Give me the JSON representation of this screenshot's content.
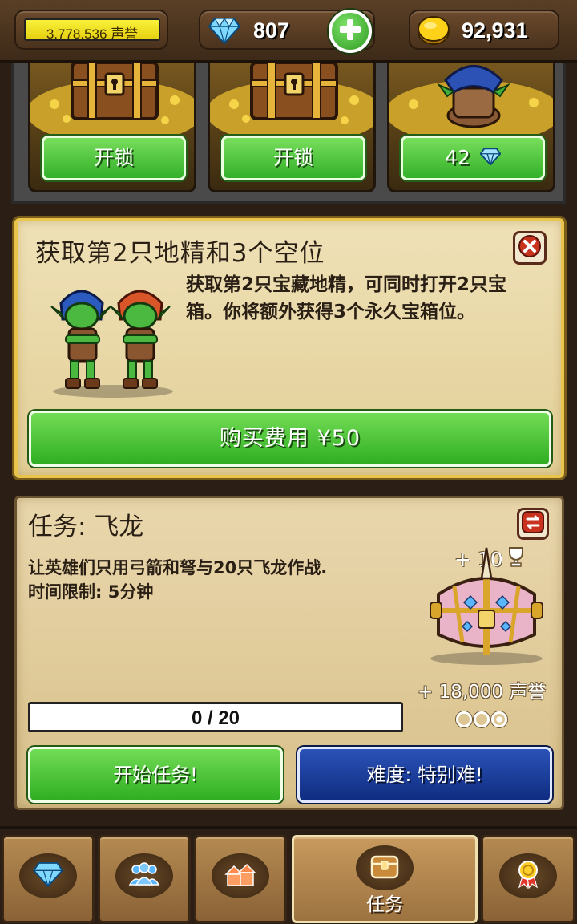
{
  "header": {
    "fame_value": "3,778,536",
    "fame_unit": "声誉",
    "gems": "807",
    "gold": "92,931"
  },
  "chests": [
    {
      "button_label": "开锁",
      "state": "locked"
    },
    {
      "button_label": "开锁",
      "state": "locked"
    },
    {
      "button_label": "42",
      "state": "opening",
      "cost_icon": "diamond-icon"
    }
  ],
  "offer": {
    "title": "获取第2只地精和3个空位",
    "description": "获取第2只宝藏地精，可同时打开2只宝箱。你将额外获得3个永久宝箱位。",
    "buy_label": "购买费用 ¥50"
  },
  "quest": {
    "title": "任务: 飞龙",
    "description_line1": "让英雄们只用弓箭和弩与20只飞龙作战.",
    "description_line2": "时间限制: 5分钟",
    "reward_trophies": "+ 10",
    "reward_fame": "+ 18,000 声誉",
    "progress_text": "0 / 20",
    "progress_current": 0,
    "progress_total": 20,
    "difficulty_dots_total": 3,
    "difficulty_dots_filled": 1,
    "start_label": "开始任务!",
    "difficulty_label": "难度: 特别难!"
  },
  "nav": {
    "tabs": [
      {
        "icon": "gem-icon",
        "label": ""
      },
      {
        "icon": "heroes-icon",
        "label": ""
      },
      {
        "icon": "town-icon",
        "label": ""
      },
      {
        "icon": "chest-icon",
        "label": "任务",
        "active": true
      },
      {
        "icon": "medal-icon",
        "label": ""
      }
    ]
  },
  "colors": {
    "green_button": "#33b02a",
    "blue_button": "#0f2d80",
    "panel_bg": "#e9d7ad",
    "fame_bar": "#f9f23a"
  }
}
